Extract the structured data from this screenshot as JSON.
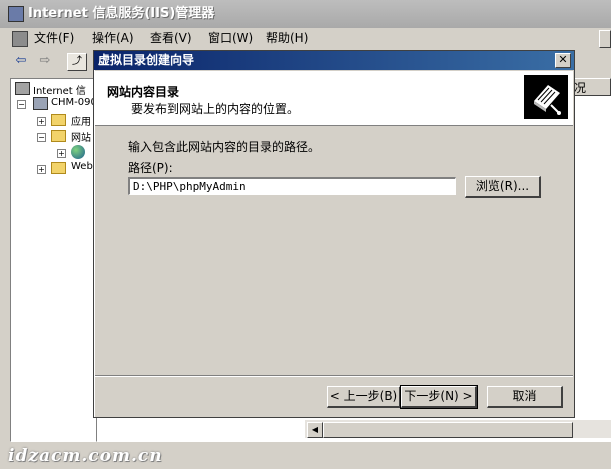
{
  "window": {
    "title": "Internet 信息服务(IIS)管理器"
  },
  "menu": {
    "file": "文件(F)",
    "action": "操作(A)",
    "view": "查看(V)",
    "window": "窗口(W)",
    "help": "帮助(H)"
  },
  "toolbar": {
    "back_icon": "back-arrow-icon",
    "forward_icon": "forward-arrow-icon",
    "up_icon": "up-folder-icon"
  },
  "tree": {
    "root": "Internet 信",
    "server": "CHM-090",
    "items": [
      {
        "label": "应用"
      },
      {
        "label": "网站"
      },
      {
        "label": ""
      },
      {
        "label": "Web"
      }
    ]
  },
  "list": {
    "column_header": "况"
  },
  "dialog": {
    "title": "虚拟目录创建向导",
    "header_title": "网站内容目录",
    "header_subtitle": "要发布到网站上的内容的位置。",
    "description": "输入包含此网站内容的目录的路径。",
    "path_label": "路径(P):",
    "path_value": "D:\\PHP\\phpMyAdmin",
    "browse_label": "浏览(R)...",
    "back_label": "< 上一步(B)",
    "next_label": "下一步(N) >",
    "cancel_label": "取消"
  },
  "watermark": "idzacm.com.cn"
}
